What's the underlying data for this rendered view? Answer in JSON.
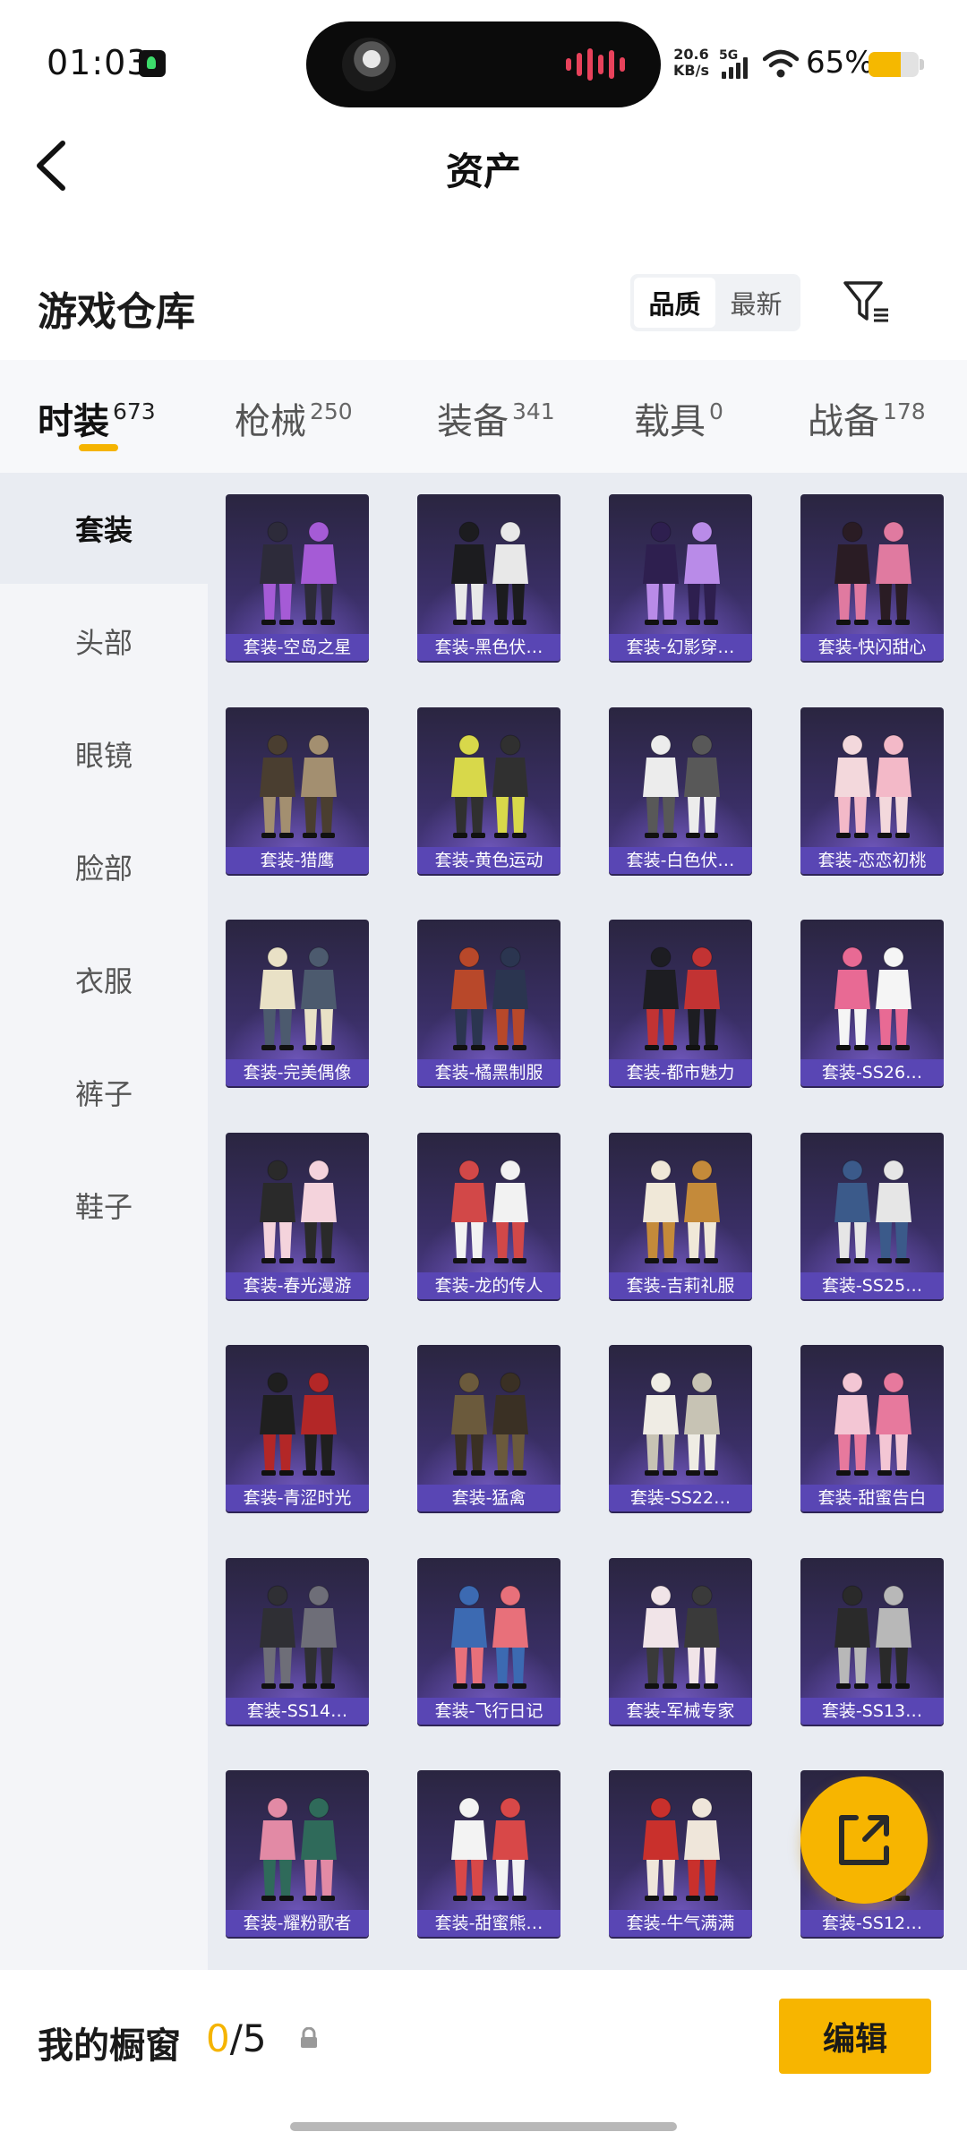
{
  "status_bar": {
    "time": "01:03",
    "net_speed_value": "20.6",
    "net_speed_unit": "KB/s",
    "network": "5G",
    "battery_percent": "65%",
    "battery_level": 0.65,
    "accent_battery": "#f5b800",
    "icons": [
      "music-app-icon",
      "signal-icon",
      "wifi-icon",
      "battery-icon"
    ]
  },
  "header": {
    "title": "资产",
    "back_icon": "chevron-left-icon"
  },
  "warehouse": {
    "title": "游戏仓库",
    "sort_options": [
      {
        "label": "品质",
        "active": true
      },
      {
        "label": "最新",
        "active": false
      }
    ],
    "filter_icon": "filter-icon"
  },
  "categories": [
    {
      "label": "时装",
      "count": "673",
      "active": true
    },
    {
      "label": "枪械",
      "count": "250",
      "active": false
    },
    {
      "label": "装备",
      "count": "341",
      "active": false
    },
    {
      "label": "载具",
      "count": "0",
      "active": false
    },
    {
      "label": "战备",
      "count": "178",
      "active": false
    }
  ],
  "sidebar": {
    "items": [
      {
        "label": "套装",
        "active": true
      },
      {
        "label": "头部",
        "active": false
      },
      {
        "label": "眼镜",
        "active": false
      },
      {
        "label": "脸部",
        "active": false
      },
      {
        "label": "衣服",
        "active": false
      },
      {
        "label": "裤子",
        "active": false
      },
      {
        "label": "鞋子",
        "active": false
      }
    ]
  },
  "items": [
    {
      "label": "套装-空岛之星"
    },
    {
      "label": "套装-黑色伏…"
    },
    {
      "label": "套装-幻影穿…"
    },
    {
      "label": "套装-快闪甜心"
    },
    {
      "label": "套装-猎鹰"
    },
    {
      "label": "套装-黄色运动"
    },
    {
      "label": "套装-白色伏…"
    },
    {
      "label": "套装-恋恋初桃"
    },
    {
      "label": "套装-完美偶像"
    },
    {
      "label": "套装-橘黑制服"
    },
    {
      "label": "套装-都市魅力"
    },
    {
      "label": "套装-SS26…"
    },
    {
      "label": "套装-春光漫游"
    },
    {
      "label": "套装-龙的传人"
    },
    {
      "label": "套装-吉莉礼服"
    },
    {
      "label": "套装-SS25…"
    },
    {
      "label": "套装-青涩时光"
    },
    {
      "label": "套装-猛禽"
    },
    {
      "label": "套装-SS22…"
    },
    {
      "label": "套装-甜蜜告白"
    },
    {
      "label": "套装-SS14…"
    },
    {
      "label": "套装-飞行日记"
    },
    {
      "label": "套装-军械专家"
    },
    {
      "label": "套装-SS13…"
    },
    {
      "label": "套装-耀粉歌者"
    },
    {
      "label": "套装-甜蜜熊…"
    },
    {
      "label": "套装-牛气满满"
    },
    {
      "label": "套装-SS12…"
    }
  ],
  "fab": {
    "icon": "share-export-icon"
  },
  "bottom_bar": {
    "showcase_label": "我的橱窗",
    "showcase_current": "0",
    "showcase_total": "/5",
    "lock_icon": "lock-icon",
    "edit_label": "编辑"
  },
  "colors": {
    "accent": "#f7b500",
    "card_label": "#5946b4",
    "card_bg": "#3a2f66"
  }
}
